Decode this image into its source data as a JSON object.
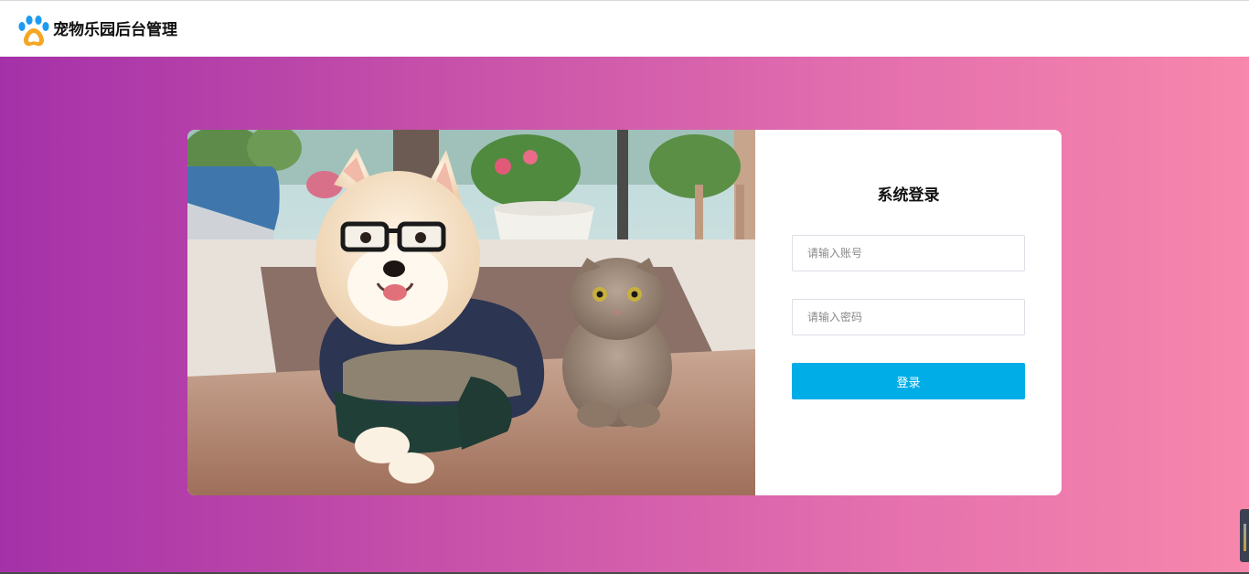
{
  "header": {
    "logo_icon": "paw-icon",
    "title": "宠物乐园后台管理"
  },
  "login": {
    "photo": "dog-and-cat-photo",
    "title": "系统登录",
    "account_placeholder": "请输入账号",
    "account_value": "",
    "password_placeholder": "请输入密码",
    "password_value": "",
    "submit_label": "登录"
  },
  "colors": {
    "gradient_start": "#a531a9",
    "gradient_end": "#f787ab",
    "button": "#00ade6"
  }
}
